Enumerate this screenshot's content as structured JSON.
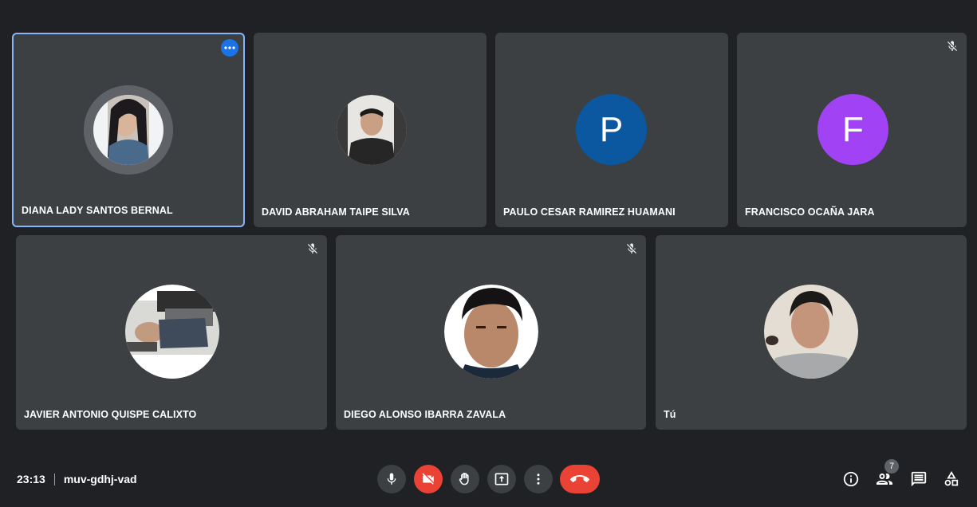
{
  "participants": [
    {
      "name": "DIANA LADY SANTOS BERNAL",
      "avatar": "photo-woman",
      "active": true,
      "muted": false
    },
    {
      "name": "DAVID ABRAHAM TAIPE SILVA",
      "avatar": "photo-man",
      "muted": false
    },
    {
      "name": "PAULO CESAR RAMIREZ HUAMANI",
      "avatar_letter": "P",
      "avatar_color": "#0b57a0",
      "muted": false
    },
    {
      "name": "FRANCISCO OCAÑA JARA",
      "avatar_letter": "F",
      "avatar_color": "#a142f4",
      "muted": true
    },
    {
      "name": "JAVIER ANTONIO QUISPE CALIXTO",
      "avatar": "photo-rotated",
      "muted": true
    },
    {
      "name": "DIEGO ALONSO IBARRA ZAVALA",
      "avatar": "photo-man",
      "muted": true
    },
    {
      "name": "Tú",
      "avatar": "photo-man",
      "muted": false
    }
  ],
  "meeting": {
    "time": "23:13",
    "code": "muv-gdhj-vad"
  },
  "controls": [
    "mic-icon",
    "camera-off-icon",
    "raise-hand-icon",
    "present-icon",
    "more-vert-icon",
    "hangup-icon"
  ],
  "right_controls": [
    "info-icon",
    "people-icon",
    "chat-icon",
    "activities-icon"
  ],
  "people_count": "7",
  "colors": {
    "background": "#202124",
    "tile": "#3c4043",
    "active_border": "#8ab4f8",
    "danger": "#ea4335"
  }
}
